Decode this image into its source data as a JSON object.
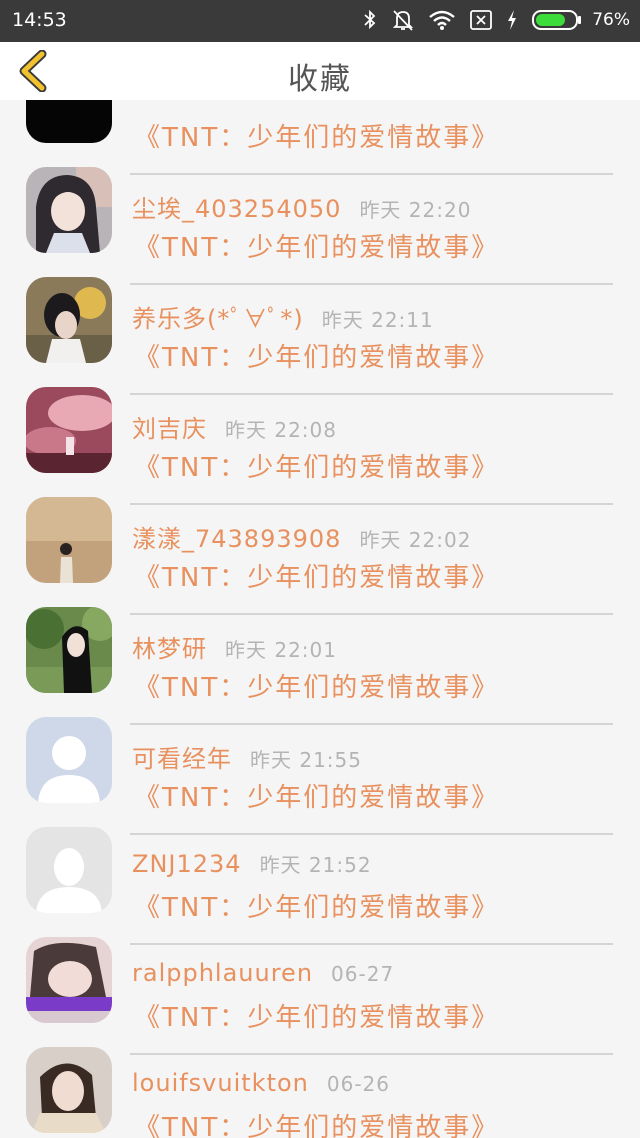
{
  "status_bar": {
    "time": "14:53",
    "battery_percent": "76%",
    "battery_level": 0.76,
    "icons": [
      "bluetooth-icon",
      "mute-notification-icon",
      "wifi-icon",
      "no-sim-icon",
      "charging-icon",
      "battery-icon"
    ]
  },
  "header": {
    "title": "收藏",
    "back_icon": "chevron-left-icon",
    "accent_color": "#f2c12e"
  },
  "colors": {
    "accent_text": "#e8915f",
    "time_text": "#b4b4b4",
    "divider": "#d4d4d4"
  },
  "items": [
    {
      "user": "",
      "time": "",
      "story": "《TNT：少年们的爱情故事》",
      "avatar": "black-avatar"
    },
    {
      "user": "尘埃_403254050",
      "time": "昨天 22:20",
      "story": "《TNT：少年们的爱情故事》",
      "avatar": "anime-girl-avatar"
    },
    {
      "user": "养乐多(*ﾟ∀ﾟ*)",
      "time": "昨天 22:11",
      "story": "《TNT：少年们的爱情故事》",
      "avatar": "photo-avatar"
    },
    {
      "user": "刘吉庆",
      "time": "昨天 22:08",
      "story": "《TNT：少年们的爱情故事》",
      "avatar": "pink-photo-avatar"
    },
    {
      "user": "漾漾_743893908",
      "time": "昨天 22:02",
      "story": "《TNT：少年们的爱情故事》",
      "avatar": "photo-avatar"
    },
    {
      "user": "林梦研",
      "time": "昨天 22:01",
      "story": "《TNT：少年们的爱情故事》",
      "avatar": "photo-avatar"
    },
    {
      "user": "可看经年",
      "time": "昨天 21:55",
      "story": "《TNT：少年们的爱情故事》",
      "avatar": "default-blue-avatar"
    },
    {
      "user": "ZNJ1234",
      "time": "昨天 21:52",
      "story": "《TNT：少年们的爱情故事》",
      "avatar": "default-grey-avatar"
    },
    {
      "user": "ralpphlauuren",
      "time": "06-27",
      "story": "《TNT：少年们的爱情故事》",
      "avatar": "photo-avatar"
    },
    {
      "user": "louifsvuitkton",
      "time": "06-26",
      "story": "《TNT：少年们的爱情故事》",
      "avatar": "photo-avatar"
    }
  ]
}
